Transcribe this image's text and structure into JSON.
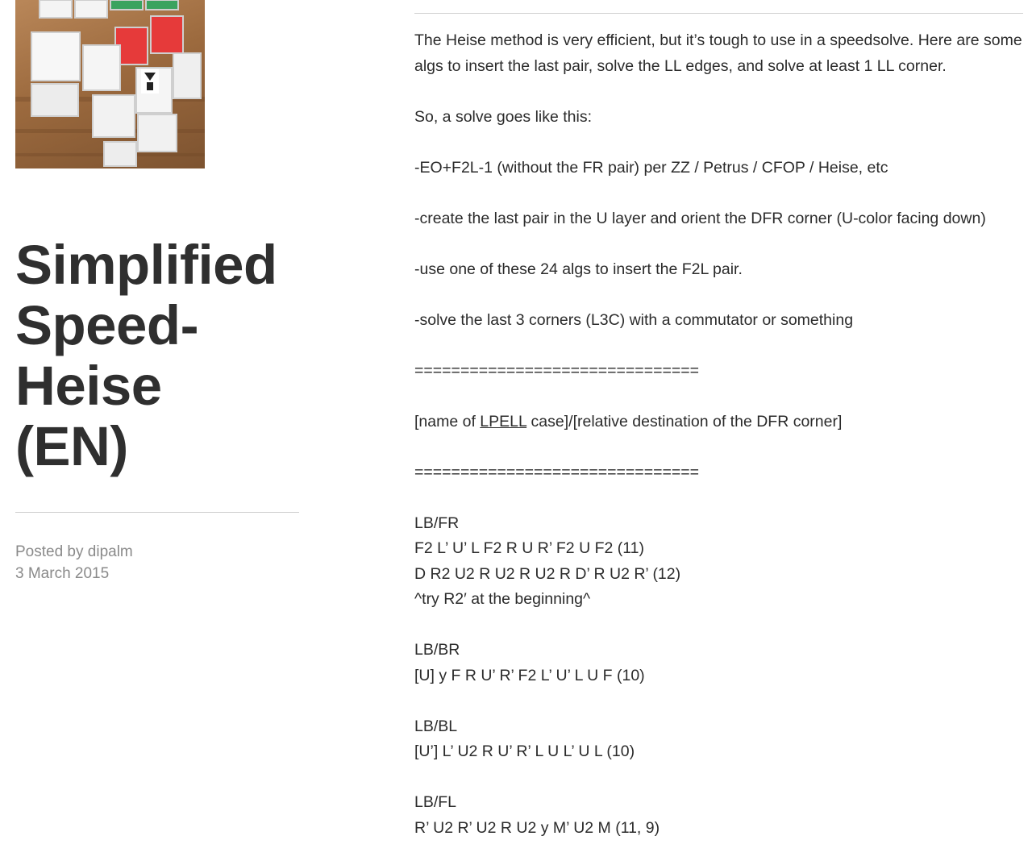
{
  "post": {
    "title_lines": [
      "Simplified",
      "Speed-",
      "Heise",
      "(EN)"
    ],
    "posted_by_prefix": "Posted by ",
    "author": "dipalm",
    "date": "3 March 2015"
  },
  "content": {
    "intro": "The Heise method is very efficient, but it’s tough to use in a speedsolve. Here are some algs to insert the last pair, solve the LL edges, and solve at least 1 LL corner.",
    "solve_intro": "So, a solve goes like this:",
    "step1": "-EO+F2L-1 (without the FR pair) per ZZ / Petrus / CFOP / Heise, etc",
    "step2": "-create the last pair in the U layer and orient the DFR corner (U-color facing down)",
    "step3": "-use one of these 24 algs to insert the F2L pair.",
    "step4": "-solve the last 3 corners (L3C) with a commutator or something",
    "separator": "===============================",
    "legend_prefix": "[name of ",
    "legend_link": "LPELL",
    "legend_suffix": " case]/[relative destination of the DFR corner]",
    "cases": [
      {
        "name": "LB/FR",
        "lines": [
          "F2 L’ U’ L F2 R U R’ F2 U F2 (11)",
          "D R2 U2 R U2 R U2 R D’ R U2 R’ (12)",
          "^try R2′ at the beginning^"
        ]
      },
      {
        "name": "LB/BR",
        "lines": [
          "[U] y F R U’ R’ F2 L’ U’ L U F (10)"
        ]
      },
      {
        "name": "LB/BL",
        "lines": [
          "[U’] L’ U2 R U’ R’ L U L’ U L (10)"
        ]
      },
      {
        "name": "LB/FL",
        "lines": [
          "R’ U2 R’ U2 R U2 y M’ U2 M (11, 9)"
        ]
      }
    ]
  }
}
